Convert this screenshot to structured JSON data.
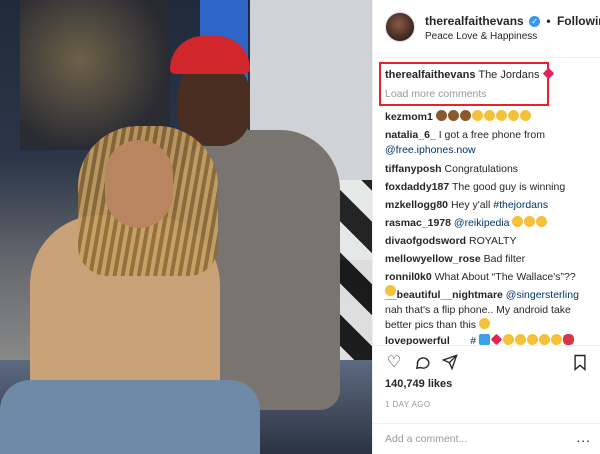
{
  "header": {
    "username": "therealfaithevans",
    "follow_label": "Following",
    "subtitle": "Peace Love & Happiness"
  },
  "caption": {
    "username": "therealfaithevans",
    "text": "The Jordans",
    "load_more": "Load more comments"
  },
  "comments": [
    {
      "user": "kezmom1",
      "text": "",
      "emojis": [
        "brown",
        "brown",
        "brown",
        "laugh",
        "laugh",
        "laugh",
        "laugh",
        "laugh"
      ]
    },
    {
      "user": "natalia_6_",
      "text": "I got a free phone from",
      "link": "@free.iphones.now"
    },
    {
      "user": "tiffanyposh",
      "text": "Congratulations"
    },
    {
      "user": "foxdaddy187",
      "text": "The good guy is winning"
    },
    {
      "user": "mzkellogg80",
      "text": "Hey y'all",
      "link": "#thejordans"
    },
    {
      "user": "rasmac_1978",
      "text": "",
      "link": "@reikipedia",
      "emojis": [
        "laugh",
        "laugh",
        "laugh"
      ]
    },
    {
      "user": "divaofgodsword",
      "text": "ROYALTY"
    },
    {
      "user": "mellowyellow_rose",
      "text": "Bad filter"
    },
    {
      "user": "ronnil0k0",
      "text": "What About “The Wallace's”??",
      "emojis": [
        "laugh"
      ]
    },
    {
      "user": "__beautiful__nightmare",
      "link": "@singersterling",
      "text": "nah that's a flip phone.. My android take better pics than this",
      "emojis": [
        "laugh"
      ]
    },
    {
      "user": "lovepowerful___",
      "text": "#",
      "emojis": [
        "blue",
        "heart",
        "laugh",
        "laugh",
        "laugh",
        "laugh",
        "laugh",
        "lips"
      ]
    }
  ],
  "stats": {
    "likes": "140,749 likes",
    "time": "1 DAY AGO"
  },
  "add_comment": {
    "placeholder": "Add a comment...",
    "more_label": "..."
  },
  "icons": {
    "like": "heart-icon",
    "comment": "comment-icon",
    "share": "share-icon",
    "save": "bookmark-icon",
    "verified": "verified-icon"
  },
  "colors": {
    "highlight": "#e8222a",
    "verified": "#3897f0",
    "link": "#003569"
  }
}
